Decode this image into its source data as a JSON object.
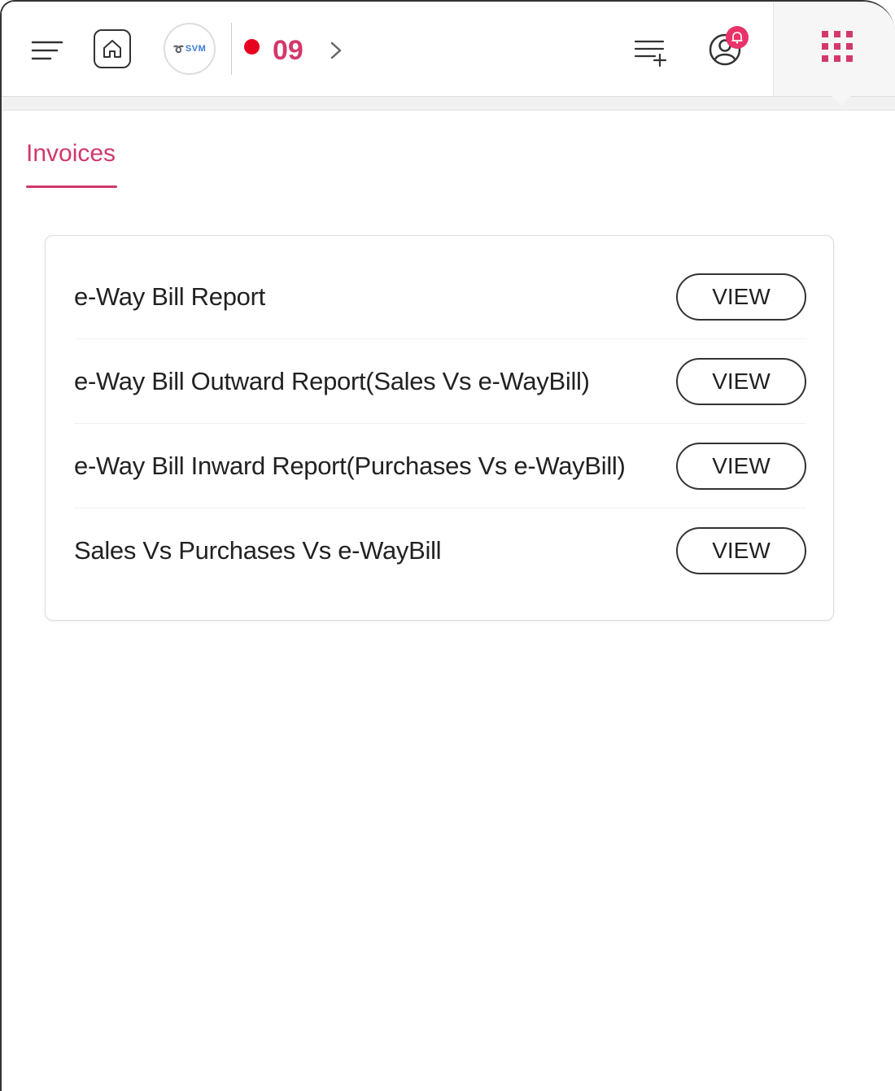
{
  "header": {
    "icons": {
      "menu": "menu-icon",
      "home": "home-icon",
      "next": "chevron-right-icon",
      "add_list": "playlist-add-icon",
      "profile": "user-circle-icon",
      "notification": "bell-icon",
      "apps": "grid-icon"
    },
    "logo_text": "SVM",
    "count": "09",
    "colors": {
      "accent": "#d2386b",
      "live_dot": "#e8001f",
      "badge": "#e8336a",
      "apps_dot": "#d2386b"
    }
  },
  "tabs": [
    {
      "label": "Invoices",
      "active": true
    }
  ],
  "reports": [
    {
      "title": "e-Way Bill Report",
      "action": "VIEW"
    },
    {
      "title": "e-Way Bill Outward Report(Sales Vs e-WayBill)",
      "action": "VIEW"
    },
    {
      "title": "e-Way Bill Inward Report(Purchases Vs e-WayBill)",
      "action": "VIEW"
    },
    {
      "title": "Sales Vs Purchases Vs e-WayBill",
      "action": "VIEW"
    }
  ]
}
